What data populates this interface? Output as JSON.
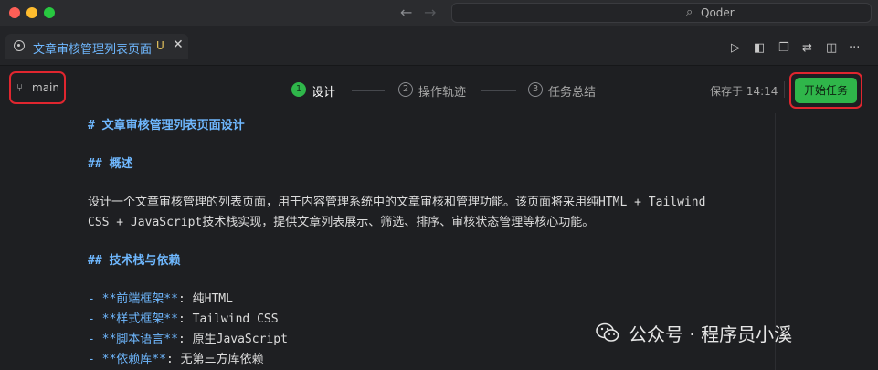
{
  "titlebar": {
    "app_name": "Qoder"
  },
  "tab": {
    "title": "文章审核管理列表页面",
    "badge": "U"
  },
  "branch": {
    "label": "main"
  },
  "steps": [
    {
      "num": "1",
      "label": "设计"
    },
    {
      "num": "2",
      "label": "操作轨迹"
    },
    {
      "num": "3",
      "label": "任务总结"
    }
  ],
  "save_time": "保存于 14:14",
  "start_button": "开始任务",
  "doc": {
    "h1": "# 文章审核管理列表页面设计",
    "h2_overview": "## 概述",
    "p1_line1": "设计一个文章审核管理的列表页面，用于内容管理系统中的文章审核和管理功能。该页面将采用纯HTML + Tailwind",
    "p1_line2": "CSS + JavaScript技术栈实现，提供文章列表展示、筛选、排序、审核状态管理等核心功能。",
    "h2_stack": "## 技术栈与依赖",
    "items": [
      {
        "bullet": "- ",
        "key": "**前端框架**",
        "sep": ": ",
        "value": "纯HTML"
      },
      {
        "bullet": "- ",
        "key": "**样式框架**",
        "sep": ": ",
        "value": "Tailwind CSS"
      },
      {
        "bullet": "- ",
        "key": "**脚本语言**",
        "sep": ": ",
        "value": "原生JavaScript"
      },
      {
        "bullet": "- ",
        "key": "**依赖库**",
        "sep": ": ",
        "value": "无第三方库依赖"
      }
    ]
  },
  "watermark": "公众号 · 程序员小溪",
  "colors": {
    "accent_green": "#2fb64a",
    "highlight_red": "#e0262f",
    "md_blue": "#6fb8ff"
  }
}
